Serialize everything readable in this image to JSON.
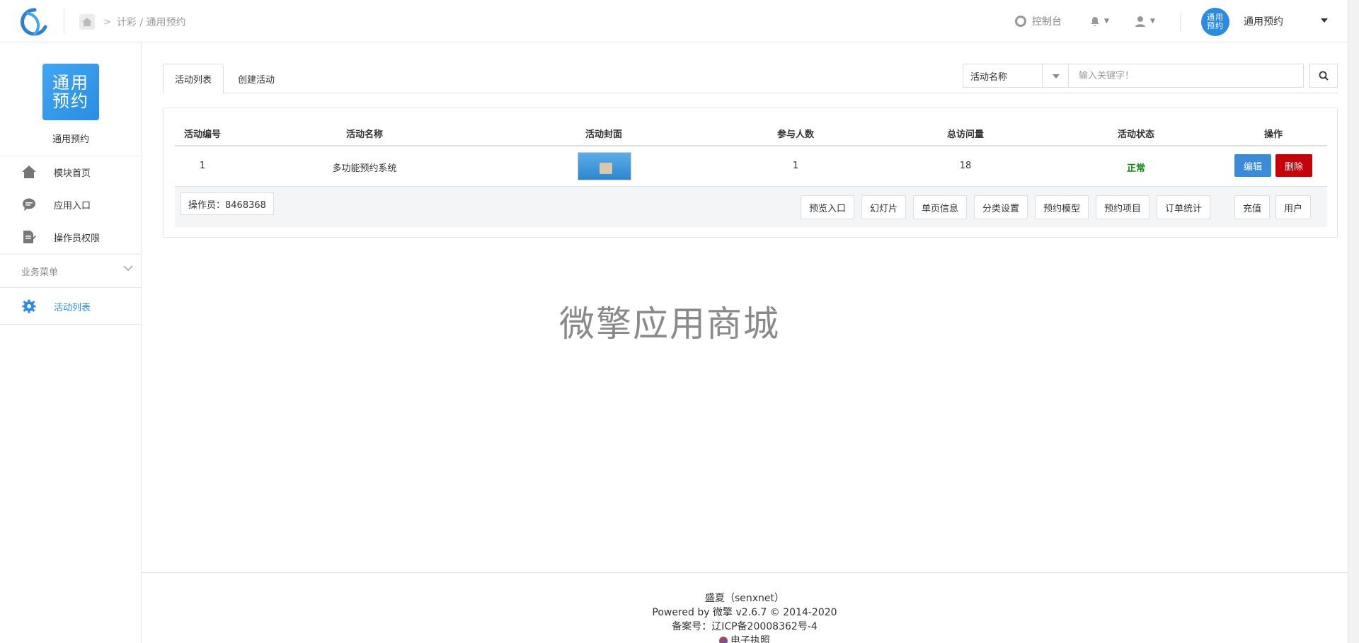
{
  "header": {
    "breadcrumb": "计彩 / 通用预约",
    "console_label": "控制台",
    "avatar_text": "通用\n预约",
    "account_name": "通用预约"
  },
  "sidebar": {
    "app_logo_text": "通用\n预约",
    "app_name": "通用预约",
    "items": [
      {
        "label": "模块首页",
        "icon": "home-icon"
      },
      {
        "label": "应用入口",
        "icon": "chat-icon"
      },
      {
        "label": "操作员权限",
        "icon": "document-edit-icon"
      }
    ],
    "group_label": "业务菜单",
    "group_items": [
      {
        "label": "活动列表",
        "icon": "gear-icon",
        "active": true
      }
    ]
  },
  "tabs": [
    {
      "label": "活动列表",
      "active": true
    },
    {
      "label": "创建活动",
      "active": false
    }
  ],
  "search": {
    "field_selected": "活动名称",
    "placeholder": "输入关键字！"
  },
  "table": {
    "columns": [
      "活动编号",
      "活动名称",
      "活动封面",
      "参与人数",
      "总访问量",
      "活动状态",
      "操作"
    ],
    "rows": [
      {
        "id": "1",
        "name": "多功能预约系统",
        "participants": "1",
        "visits": "18",
        "status": "正常"
      }
    ],
    "edit_label": "编辑",
    "delete_label": "删除",
    "operator": "操作员：8468368",
    "footer_buttons": [
      "预览入口",
      "幻灯片",
      "单页信息",
      "分类设置",
      "预约模型",
      "预约项目",
      "订单统计",
      "充值",
      "用户"
    ]
  },
  "watermark": "微擎应用商城",
  "footer": {
    "line1": "盛夏（senxnet）",
    "line2": "Powered by 微擎 v2.6.7 © 2014-2020",
    "line3": "备案号：辽ICP备20008362号-4",
    "line4": "电子执照"
  },
  "colors": {
    "primary": "#2a8ae6",
    "danger": "#c8000a",
    "success": "#0a8a0a"
  }
}
